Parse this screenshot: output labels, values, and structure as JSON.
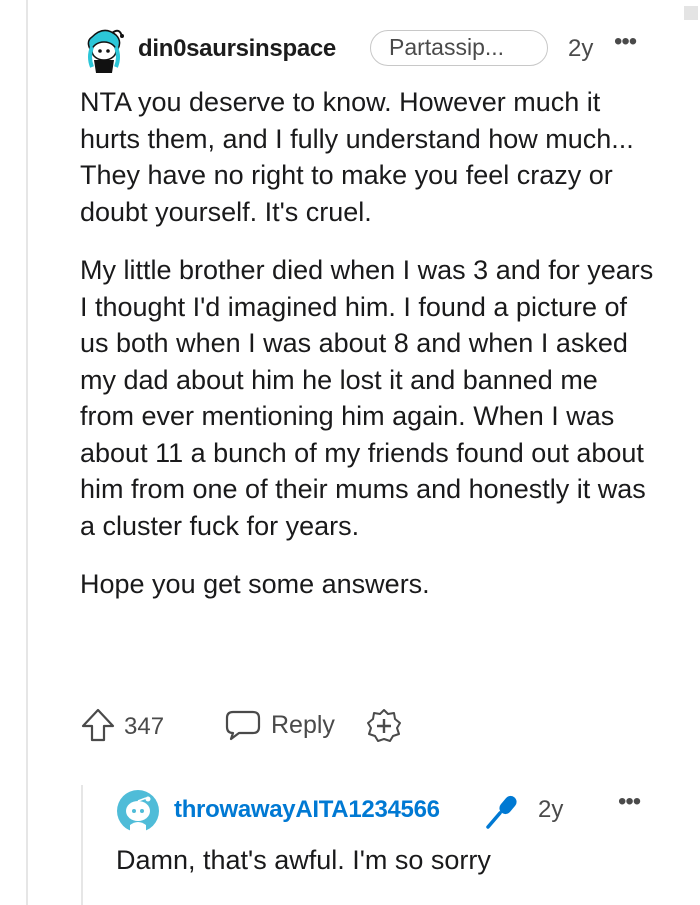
{
  "comment": {
    "author": "din0saursinspace",
    "flair": "Partassip...",
    "age": "2y",
    "more_label": "•••",
    "paragraphs": [
      "NTA you deserve to know. However much it hurts them, and I fully understand how much... They have no right to make you feel crazy or doubt yourself. It's cruel.",
      "My little brother died when I was 3 and for years I thought I'd imagined him. I found a picture of us both when I was about 8 and when I asked my dad about him he lost it and banned me from ever mentioning him again. When I was about 11 a bunch of my friends found out about him from one of their mums and honestly it was a cluster fuck for years.",
      "Hope you get some answers."
    ],
    "score": "347",
    "reply_label": "Reply",
    "icons": {
      "avatar": "snoo-avatar-icon",
      "upvote": "upvote-arrow-icon",
      "reply": "speech-bubble-icon",
      "award": "award-plus-icon",
      "more": "more-dots-icon"
    }
  },
  "reply": {
    "author": "throwawayAITA1234566",
    "age": "2y",
    "more_label": "•••",
    "body": "Damn, that's awful. I'm so sorry",
    "icons": {
      "avatar": "snoo-avatar-icon",
      "badge": "microphone-icon",
      "more": "more-dots-icon"
    }
  },
  "colors": {
    "username_op": "#0079d3",
    "text": "#1a1a1b",
    "meta": "#4a4a4a",
    "thread_line": "#e6e6e6"
  }
}
